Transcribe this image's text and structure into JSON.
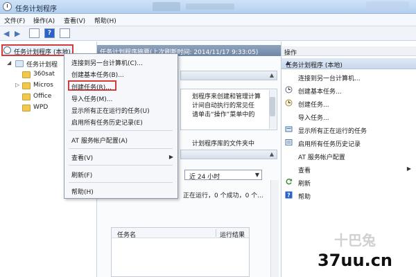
{
  "window": {
    "title": "任务计划程序"
  },
  "menubar": {
    "items": [
      "文件(F)",
      "操作(A)",
      "查看(V)",
      "帮助(H)"
    ]
  },
  "tree": {
    "root": "任务计划程序 (本地)",
    "library": "任务计划程",
    "folders": [
      "360sat",
      "Micros",
      "Office",
      "WPD"
    ]
  },
  "center": {
    "header": "任务计划程序摘要(上次刷新时间: 2014/11/17 9:33:05)",
    "desc_lines": [
      "划程序来创建和管理计算",
      "计间自动执行的常见任",
      "请单击“操作”菜单中的"
    ],
    "section_line": "计划程序库的文件夹中",
    "period": "近 24 小时",
    "status": "正在运行，0 个成功，0 个...",
    "table": {
      "col_name": "任务名",
      "col_result": "运行结果"
    }
  },
  "context_menu": {
    "items": [
      "连接到另一台计算机(C)...",
      "创建基本任务(B)...",
      "创建任务(R)...",
      "导入任务(M)...",
      "显示所有正在运行的任务(U)",
      "启用所有任务历史记录(E)",
      "AT 服务帐户配置(A)",
      "查看(V)",
      "刷新(F)",
      "帮助(H)"
    ]
  },
  "actions": {
    "title": "操作",
    "group": "任务计划程序 (本地)",
    "items": [
      {
        "label": "连接到另一台计算机...",
        "icon": "connect-icon"
      },
      {
        "label": "创建基本任务...",
        "icon": "basic-task-icon"
      },
      {
        "label": "创建任务...",
        "icon": "task-icon"
      },
      {
        "label": "导入任务...",
        "icon": "import-icon"
      },
      {
        "label": "显示所有正在运行的任务",
        "icon": "running-icon"
      },
      {
        "label": "启用所有任务历史记录",
        "icon": "history-icon"
      },
      {
        "label": "AT 服务帐户配置",
        "icon": "account-icon"
      },
      {
        "label": "查看",
        "icon": "view-icon"
      },
      {
        "label": "刷新",
        "icon": "refresh-icon"
      },
      {
        "label": "帮助",
        "icon": "help-icon"
      }
    ]
  },
  "watermark": {
    "site": "37uu.cn",
    "logo": "十巴兔"
  },
  "colors": {
    "highlight": "#d23b3b",
    "accent": "#2a62c9"
  }
}
